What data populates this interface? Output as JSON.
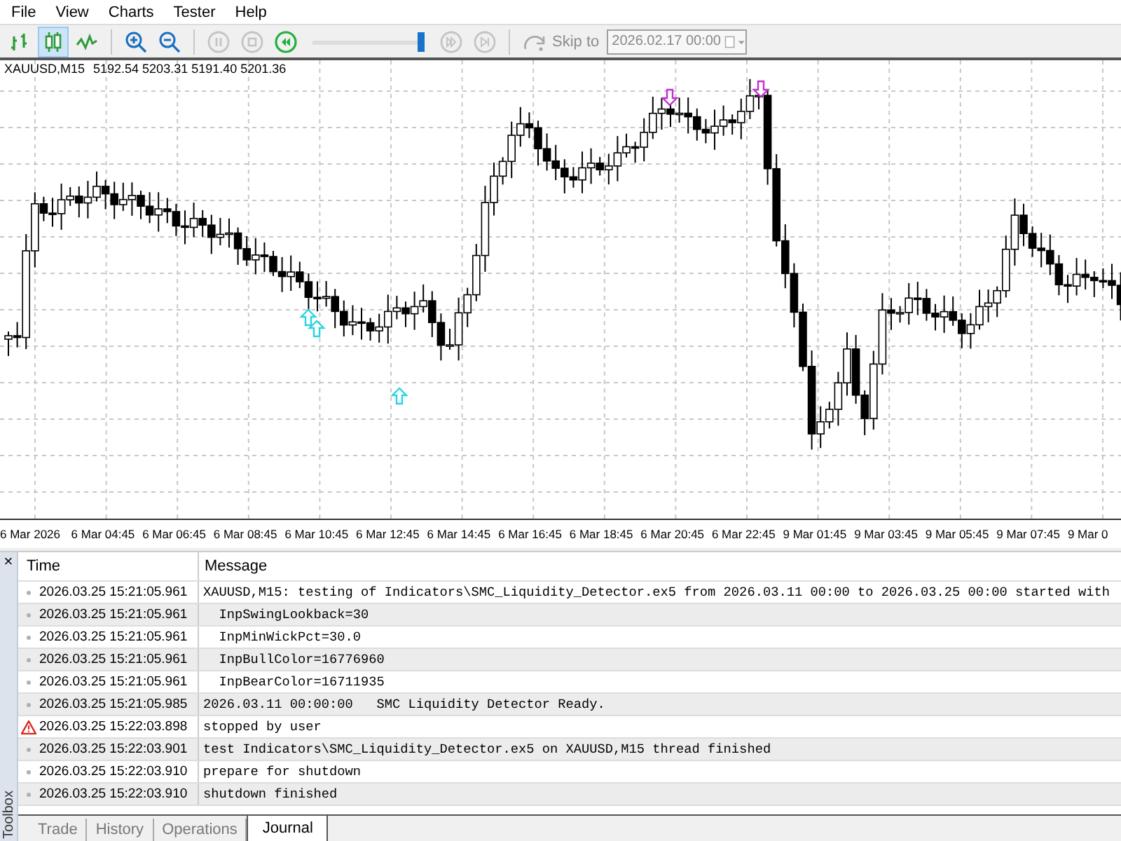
{
  "menu": [
    {
      "label": "File"
    },
    {
      "label": "View"
    },
    {
      "label": "Charts"
    },
    {
      "label": "Tester"
    },
    {
      "label": "Help"
    }
  ],
  "toolbar": {
    "chart_modes": [
      {
        "kind": "bars",
        "selected": false
      },
      {
        "kind": "candles",
        "selected": true
      },
      {
        "kind": "line",
        "selected": false
      }
    ],
    "zoom": [
      {
        "kind": "zoom_in"
      },
      {
        "kind": "zoom_out"
      }
    ],
    "playback": [
      {
        "kind": "pause",
        "disabled": true
      },
      {
        "kind": "stop",
        "disabled": true
      },
      {
        "kind": "rewind",
        "disabled": false
      }
    ],
    "speed": {
      "level": 0.97
    },
    "stepping": [
      {
        "kind": "forward",
        "disabled": true
      },
      {
        "kind": "end",
        "disabled": true
      }
    ],
    "skip_to": {
      "label": "Skip to",
      "disabled": true,
      "value": "2026.02.17 00:00"
    }
  },
  "chart": {
    "symbol": "XAUUSD,M15",
    "ohlc": "5192.54 5203.31 5191.40 5201.36",
    "time_labels": [
      "6 Mar 2026",
      "6 Mar 04:45",
      "6 Mar 06:45",
      "6 Mar 08:45",
      "6 Mar 10:45",
      "6 Mar 12:45",
      "6 Mar 14:45",
      "6 Mar 16:45",
      "6 Mar 18:45",
      "6 Mar 20:45",
      "6 Mar 22:45",
      "9 Mar 01:45",
      "9 Mar 03:45",
      "9 Mar 05:45",
      "9 Mar 07:45",
      "9 Mar 0"
    ]
  },
  "journal": {
    "close_label": "×",
    "side_label": "Toolbox",
    "columns": [
      "Time",
      "Message"
    ],
    "rows": [
      {
        "kind": "info",
        "time": "2026.03.25 15:21:05.961",
        "message": "XAUUSD,M15: testing of Indicators\\SMC_Liquidity_Detector.ex5 from 2026.03.11 00:00 to 2026.03.25 00:00 started with"
      },
      {
        "kind": "info",
        "time": "2026.03.25 15:21:05.961",
        "message": "  InpSwingLookback=30"
      },
      {
        "kind": "info",
        "time": "2026.03.25 15:21:05.961",
        "message": "  InpMinWickPct=30.0"
      },
      {
        "kind": "info",
        "time": "2026.03.25 15:21:05.961",
        "message": "  InpBullColor=16776960"
      },
      {
        "kind": "info",
        "time": "2026.03.25 15:21:05.961",
        "message": "  InpBearColor=16711935"
      },
      {
        "kind": "info",
        "time": "2026.03.25 15:21:05.985",
        "message": "2026.03.11 00:00:00   SMC Liquidity Detector Ready."
      },
      {
        "kind": "warning",
        "time": "2026.03.25 15:22:03.898",
        "message": "stopped by user"
      },
      {
        "kind": "info",
        "time": "2026.03.25 15:22:03.901",
        "message": "test Indicators\\SMC_Liquidity_Detector.ex5 on XAUUSD,M15 thread finished"
      },
      {
        "kind": "info",
        "time": "2026.03.25 15:22:03.910",
        "message": "prepare for shutdown"
      },
      {
        "kind": "info",
        "time": "2026.03.25 15:22:03.910",
        "message": "shutdown finished"
      }
    ],
    "tabs": [
      {
        "label": "Trade",
        "selected": false
      },
      {
        "label": "History",
        "selected": false
      },
      {
        "label": "Operations",
        "selected": false
      },
      {
        "label": "Journal",
        "selected": true
      }
    ]
  }
}
